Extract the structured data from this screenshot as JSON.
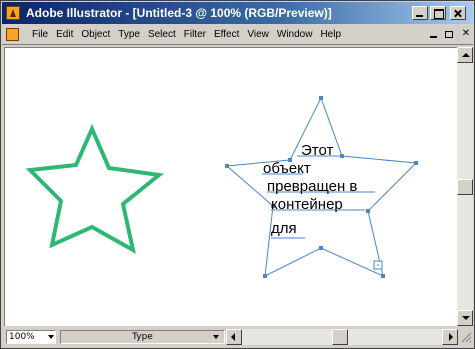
{
  "window": {
    "title": "Adobe Illustrator - [Untitled-3 @ 100% (RGB/Preview)]"
  },
  "menu": {
    "items": [
      "File",
      "Edit",
      "Object",
      "Type",
      "Select",
      "Filter",
      "Effect",
      "View",
      "Window",
      "Help"
    ]
  },
  "canvas": {
    "text_lines": [
      "Этот",
      "объект",
      "превращен в",
      "контейнер",
      "для"
    ],
    "star_color": "#2eb873",
    "path_color": "#4a86c8"
  },
  "status": {
    "zoom": "100%",
    "tool": "Type"
  },
  "icons": [
    "illustrator-app-icon",
    "document-icon",
    "minimize-icon",
    "maximize-icon",
    "close-icon",
    "scroll-up-icon",
    "scroll-down-icon",
    "scroll-left-icon",
    "scroll-right-icon",
    "dropdown-icon"
  ]
}
